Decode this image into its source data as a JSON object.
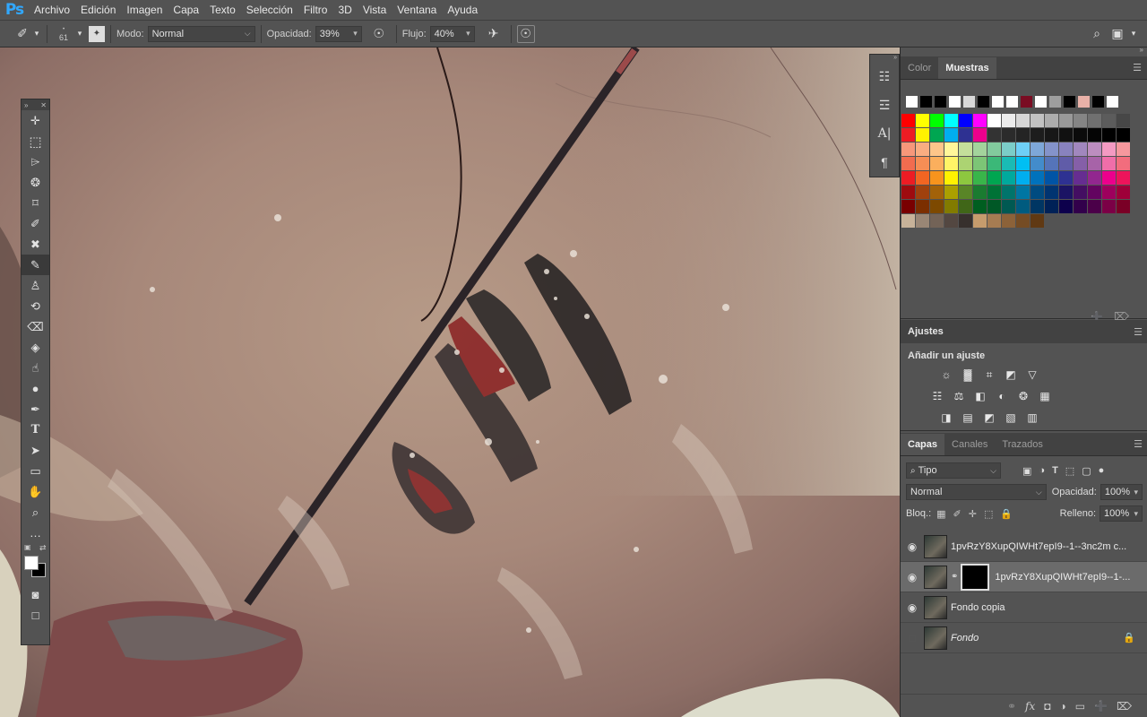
{
  "app": {
    "logo": "Ps"
  },
  "menu": [
    "Archivo",
    "Edición",
    "Imagen",
    "Capa",
    "Texto",
    "Selección",
    "Filtro",
    "3D",
    "Vista",
    "Ventana",
    "Ayuda"
  ],
  "options": {
    "brush_size": "61",
    "mode_label": "Modo:",
    "mode_value": "Normal",
    "opacity_label": "Opacidad:",
    "opacity_value": "39%",
    "flow_label": "Flujo:",
    "flow_value": "40%"
  },
  "color_panel": {
    "tabs": [
      "Color",
      "Muestras"
    ],
    "active_tab": "Muestras"
  },
  "swatches": {
    "recent": [
      "#ffffff",
      "#000000",
      "#000000",
      "#ffffff",
      "#d8d8d8",
      "#000000",
      "#ffffff",
      "#ffffff",
      "#7a0d23",
      "#ffffff",
      "#9e9e9e",
      "#000000",
      "#e9b1a8",
      "#000000",
      "#ffffff"
    ],
    "rows": [
      [
        "#ff0000",
        "#ffff00",
        "#00ff00",
        "#00ffff",
        "#0000ff",
        "#ff00ff",
        "#ffffff",
        "#ebebeb",
        "#d6d6d6",
        "#c2c2c2",
        "#adadad",
        "#999999",
        "#858585",
        "#707070",
        "#5c5c5c",
        "#474747"
      ],
      [
        "#ed1c24",
        "#fff200",
        "#00a651",
        "#00aeef",
        "#2e3192",
        "#ec008c",
        "#333333",
        "#2b2b2b",
        "#242424",
        "#1d1d1d",
        "#171717",
        "#111111",
        "#0b0b0b",
        "#050505",
        "#000000",
        "#000000"
      ],
      [
        "#f7977a",
        "#f9ad81",
        "#fdc68a",
        "#fff79a",
        "#c4df9b",
        "#a3d39c",
        "#82ca9d",
        "#7bcdc8",
        "#6ecff6",
        "#7ea7d8",
        "#8493ca",
        "#8882be",
        "#a187be",
        "#bc8dbf",
        "#f49ac2",
        "#f6989d"
      ],
      [
        "#f26c4f",
        "#f68e55",
        "#fbaf5d",
        "#fff467",
        "#acd372",
        "#7cc576",
        "#3bb878",
        "#1abbb4",
        "#00bff3",
        "#438ccb",
        "#5574b9",
        "#605ca8",
        "#855fa8",
        "#a763a8",
        "#f06ea9",
        "#f26d7d"
      ],
      [
        "#ed1c24",
        "#f26522",
        "#f7941d",
        "#fff200",
        "#8dc73f",
        "#39b54a",
        "#00a651",
        "#00a99d",
        "#00aeef",
        "#0072bc",
        "#0054a6",
        "#2e3192",
        "#662d91",
        "#92278f",
        "#ec008c",
        "#ed145b"
      ],
      [
        "#9e0b0f",
        "#a0410d",
        "#a36209",
        "#aba000",
        "#598527",
        "#1a7b30",
        "#007236",
        "#00746b",
        "#0076a3",
        "#004b80",
        "#003471",
        "#1b1464",
        "#440e62",
        "#630460",
        "#9e005d",
        "#9e0039"
      ],
      [
        "#790000",
        "#7b2e00",
        "#7d4900",
        "#827b00",
        "#406618",
        "#005e20",
        "#005826",
        "#005952",
        "#005b7f",
        "#003663",
        "#002157",
        "#0d004c",
        "#32004b",
        "#4b0049",
        "#7b0046",
        "#7a0026"
      ],
      [
        "#c7b299",
        "#998675",
        "#736357",
        "#534741",
        "#37302d",
        "#c69c6d",
        "#a67c52",
        "#8c6239",
        "#754c24",
        "#603913"
      ]
    ]
  },
  "ajustes": {
    "title": "Ajustes",
    "subtitle": "Añadir un ajuste",
    "row1": [
      "brightness-icon",
      "levels-icon",
      "curves-icon",
      "exposure-icon",
      "vibrance-icon"
    ],
    "row2": [
      "hue-saturation-icon",
      "color-balance-icon",
      "black-white-icon",
      "photo-filter-icon",
      "channel-mixer-icon",
      "color-lookup-icon"
    ],
    "row3": [
      "invert-icon",
      "posterize-icon",
      "threshold-icon",
      "selective-color-icon",
      "gradient-map-icon"
    ]
  },
  "layers_panel": {
    "tabs": [
      "Capas",
      "Canales",
      "Trazados"
    ],
    "active_tab": "Capas",
    "filter_label": "Tipo",
    "blend_mode": "Normal",
    "opacity_label": "Opacidad:",
    "opacity_value": "100%",
    "lock_label": "Bloq.:",
    "fill_label": "Relleno:",
    "fill_value": "100%",
    "layers": [
      {
        "name": "1pvRzY8XupQIWHt7epI9--1--3nc2m c...",
        "visible": true,
        "mask": false,
        "selected": false,
        "italic": false,
        "locked": false
      },
      {
        "name": "1pvRzY8XupQIWHt7epI9--1-...",
        "visible": true,
        "mask": true,
        "selected": true,
        "italic": false,
        "locked": false
      },
      {
        "name": "Fondo copia",
        "visible": true,
        "mask": false,
        "selected": false,
        "italic": false,
        "locked": false
      },
      {
        "name": "Fondo",
        "visible": false,
        "mask": false,
        "selected": false,
        "italic": true,
        "locked": true
      }
    ]
  }
}
